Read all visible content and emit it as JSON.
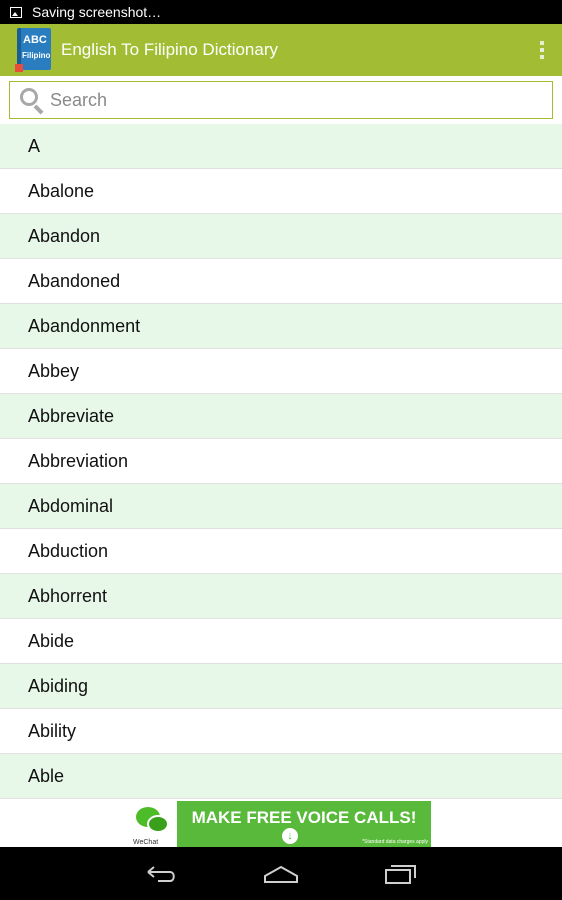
{
  "status_bar": {
    "notification_text": "Saving screenshot…"
  },
  "action_bar": {
    "title": "English To Filipino Dictionary",
    "app_icon_text_top": "ABC",
    "app_icon_text_bottom": "Filipino",
    "accent_color": "#a2bd33"
  },
  "search": {
    "placeholder": "Search",
    "value": ""
  },
  "word_list": {
    "items": [
      {
        "word": "A"
      },
      {
        "word": "Abalone"
      },
      {
        "word": "Abandon"
      },
      {
        "word": "Abandoned"
      },
      {
        "word": "Abandonment"
      },
      {
        "word": "Abbey"
      },
      {
        "word": "Abbreviate"
      },
      {
        "word": "Abbreviation"
      },
      {
        "word": "Abdominal"
      },
      {
        "word": "Abduction"
      },
      {
        "word": "Abhorrent"
      },
      {
        "word": "Abide"
      },
      {
        "word": "Abiding"
      },
      {
        "word": "Ability"
      },
      {
        "word": "Able"
      }
    ],
    "alt_row_color": "#e8f8e8"
  },
  "ad": {
    "headline": "MAKE FREE VOICE CALLS!",
    "logo_label": "WeChat",
    "disclaimer": "*Standard data charges apply",
    "background_color": "#58b93b"
  },
  "nav_bar": {
    "buttons": [
      "back-icon",
      "home-icon",
      "recents-icon"
    ]
  }
}
